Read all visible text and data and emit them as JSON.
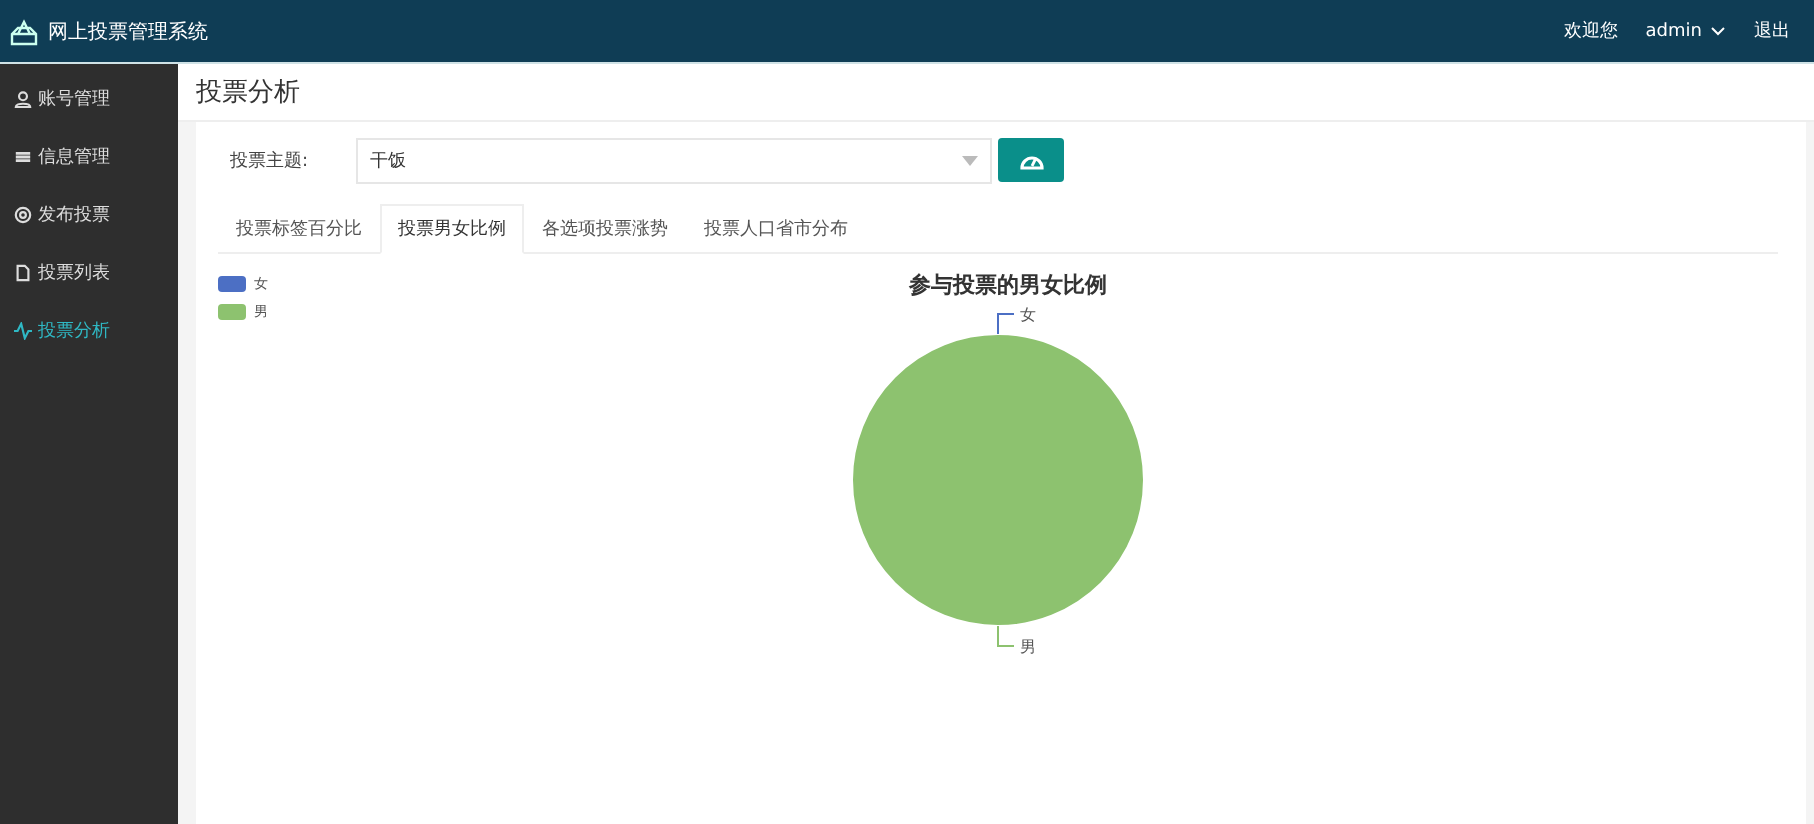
{
  "header": {
    "title": "网上投票管理系统",
    "welcome": "欢迎您",
    "user": "admin",
    "logout": "退出"
  },
  "sidebar": {
    "items": [
      {
        "label": "账号管理",
        "selected": false
      },
      {
        "label": "信息管理",
        "selected": false
      },
      {
        "label": "发布投票",
        "selected": false
      },
      {
        "label": "投票列表",
        "selected": false
      },
      {
        "label": "投票分析",
        "selected": true
      }
    ]
  },
  "page_title": "投票分析",
  "filter": {
    "label": "投票主题:",
    "value": "干饭"
  },
  "tabs": [
    {
      "label": "投票标签百分比",
      "selected": false
    },
    {
      "label": "投票男女比例",
      "selected": true
    },
    {
      "label": "各选项投票涨势",
      "selected": false
    },
    {
      "label": "投票人口省市分布",
      "selected": false
    }
  ],
  "chart_data": {
    "type": "pie",
    "title": "参与投票的男女比例",
    "categories": [
      "女",
      "男"
    ],
    "values": [
      0,
      1
    ],
    "colors": [
      "#4c6fc4",
      "#8dc26f"
    ]
  }
}
